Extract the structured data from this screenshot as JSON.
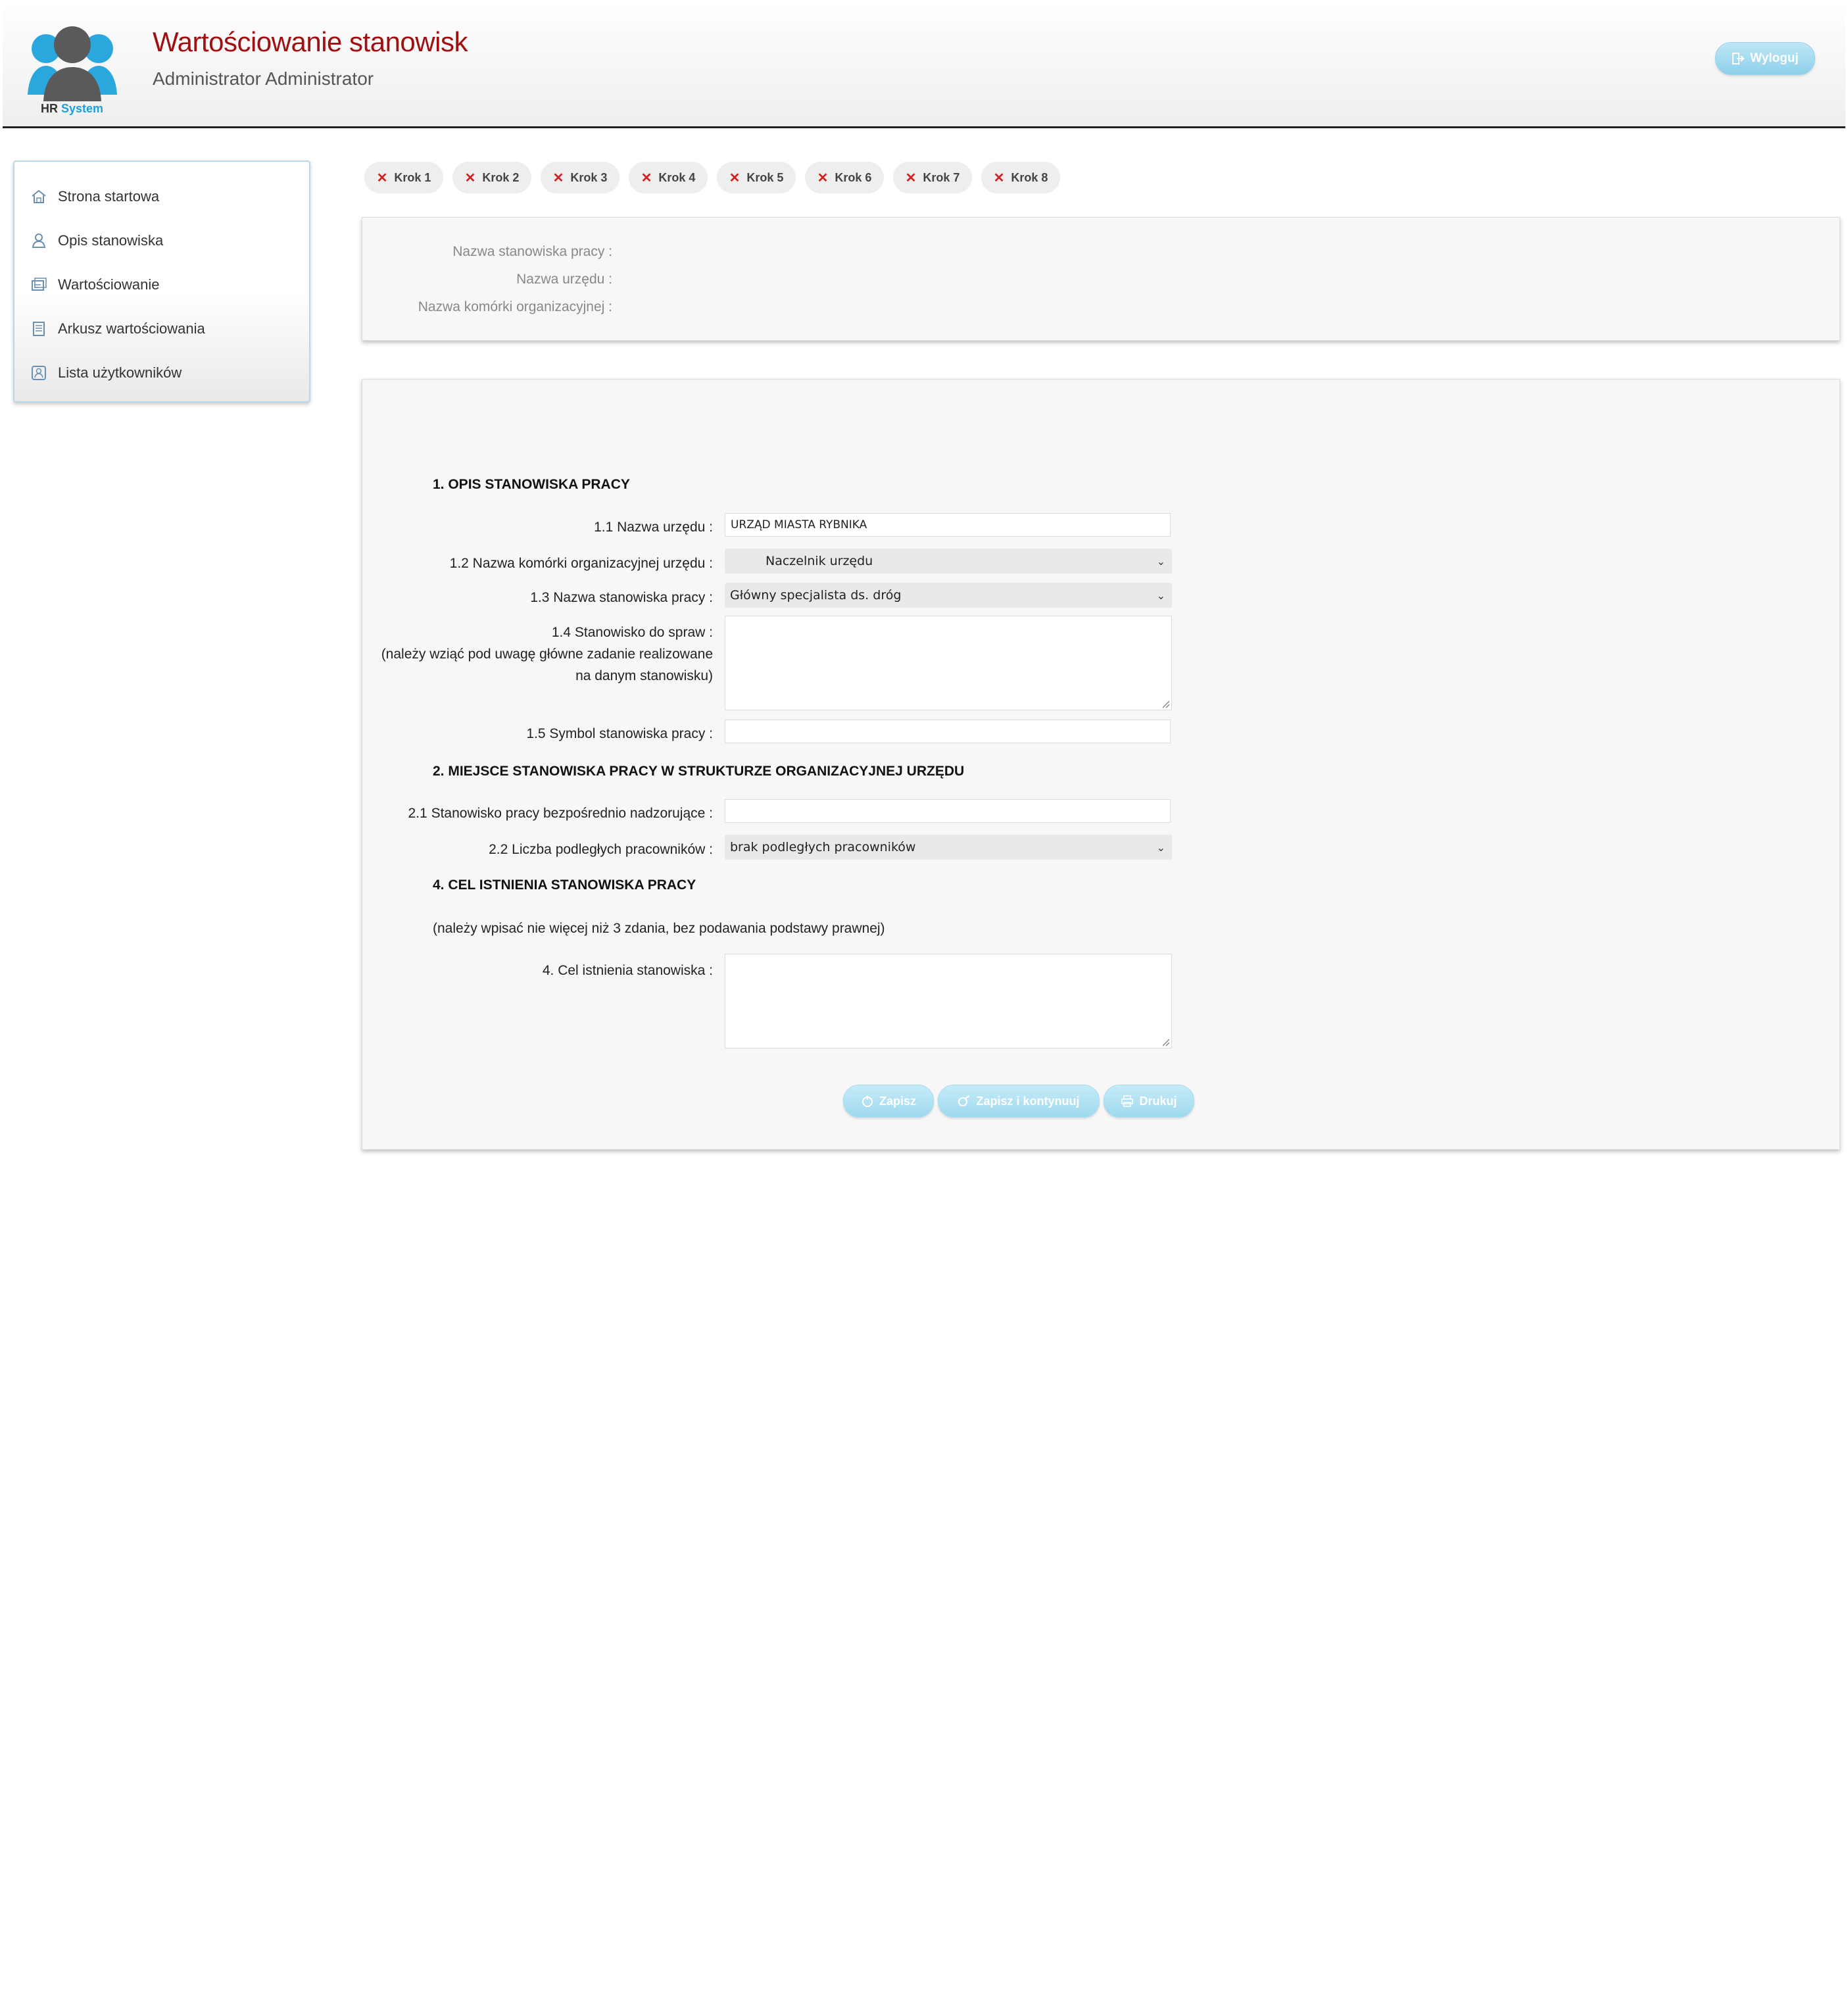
{
  "header": {
    "logo_text_a": "HR",
    "logo_text_b": "System",
    "title": "Wartościowanie stanowisk",
    "user": "Administrator Administrator",
    "logout_label": "Wyloguj"
  },
  "sidebar": {
    "items": [
      {
        "label": "Strona startowa",
        "icon": "home-icon"
      },
      {
        "label": "Opis stanowiska",
        "icon": "person-icon"
      },
      {
        "label": "Wartościowanie",
        "icon": "cards-icon"
      },
      {
        "label": "Arkusz wartościowania",
        "icon": "sheet-icon"
      },
      {
        "label": "Lista użytkowników",
        "icon": "users-list-icon"
      }
    ]
  },
  "steps": [
    {
      "label": "Krok 1"
    },
    {
      "label": "Krok 2"
    },
    {
      "label": "Krok 3"
    },
    {
      "label": "Krok 4"
    },
    {
      "label": "Krok 5"
    },
    {
      "label": "Krok 6"
    },
    {
      "label": "Krok 7"
    },
    {
      "label": "Krok 8"
    }
  ],
  "info": {
    "position_label": "Nazwa stanowiska pracy :",
    "office_label": "Nazwa urzędu :",
    "unit_label": "Nazwa komórki organizacyjnej :"
  },
  "form": {
    "section1": "1. OPIS STANOWISKA PRACY",
    "f11_label": "1.1 Nazwa urzędu :",
    "f11_value": "URZĄD MIASTA RYBNIKA",
    "f12_label": "1.2 Nazwa komórki organizacyjnej urzędu :",
    "f12_value": "Naczelnik urzędu",
    "f13_label": "1.3 Nazwa stanowiska pracy :",
    "f13_value": "Główny specjalista ds. dróg",
    "f14_label_1": "1.4 Stanowisko do spraw :",
    "f14_label_2": "(należy wziąć pod uwagę główne zadanie realizowane",
    "f14_label_3": "na danym stanowisku)",
    "f15_label": "1.5 Symbol stanowiska pracy :",
    "section2": "2. MIEJSCE STANOWISKA PRACY W STRUKTURZE ORGANIZACYJNEJ URZĘDU",
    "f21_label": "2.1 Stanowisko pracy bezpośrednio nadzorujące :",
    "f22_label": "2.2 Liczba podległych pracowników :",
    "f22_value": "brak podległych pracowników",
    "section4": "4. CEL ISTNIENIA STANOWISKA PRACY",
    "note4": "(należy wpisać nie więcej niż 3 zdania, bez podawania podstawy prawnej)",
    "f4_label": "4. Cel istnienia stanowiska :"
  },
  "buttons": {
    "save": "Zapisz",
    "save_continue": "Zapisz i kontynuuj",
    "print": "Drukuj"
  },
  "colors": {
    "title": "#a01010",
    "step_x": "#d21f1f",
    "button": "#9fd9ee",
    "logo": "#1ea0d8"
  }
}
